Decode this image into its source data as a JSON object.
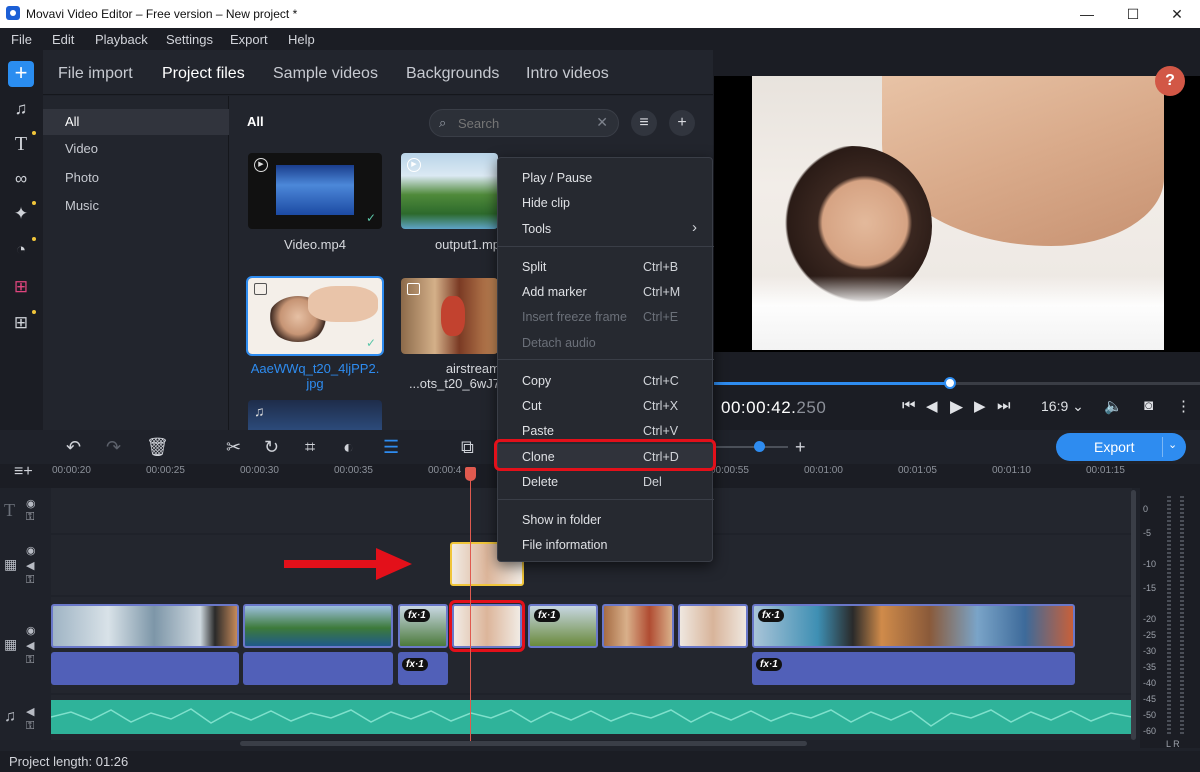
{
  "window": {
    "title": "Movavi Video Editor – Free version – New project *",
    "min": "—",
    "max": "☐",
    "close": "✕"
  },
  "menu": [
    "File",
    "Edit",
    "Playback",
    "Settings",
    "Export",
    "Help"
  ],
  "media_tabs": [
    "File import",
    "Project files",
    "Sample videos",
    "Backgrounds",
    "Intro videos"
  ],
  "categories": [
    "All",
    "Video",
    "Photo",
    "Music"
  ],
  "files_panel": {
    "heading": "All",
    "search_placeholder": "Search"
  },
  "files": [
    {
      "name": "Video.mp4",
      "type": "video"
    },
    {
      "name": "output1.mp",
      "type": "video"
    },
    {
      "name": "AaeWWq_t20_4ljPP2.",
      "name2": "jpg",
      "type": "image"
    },
    {
      "name": "airstream",
      "name2": "...ots_t20_6wJ7",
      "type": "image"
    }
  ],
  "context_menu": [
    {
      "label": "Play / Pause",
      "key": ""
    },
    {
      "label": "Hide clip",
      "key": ""
    },
    {
      "label": "Tools",
      "key": "›"
    },
    {
      "label": "Split",
      "key": "Ctrl+B"
    },
    {
      "label": "Add marker",
      "key": "Ctrl+M"
    },
    {
      "label": "Insert freeze frame",
      "key": "Ctrl+E"
    },
    {
      "label": "Detach audio",
      "key": ""
    },
    {
      "label": "Copy",
      "key": "Ctrl+C"
    },
    {
      "label": "Cut",
      "key": "Ctrl+X"
    },
    {
      "label": "Paste",
      "key": "Ctrl+V"
    },
    {
      "label": "Clone",
      "key": "Ctrl+D"
    },
    {
      "label": "Delete",
      "key": "Del"
    },
    {
      "label": "Show in folder",
      "key": ""
    },
    {
      "label": "File information",
      "key": ""
    }
  ],
  "player": {
    "time_main": "00:00:42.",
    "time_ms": "250",
    "aspect": "16:9 ⌄",
    "progress": 0.485
  },
  "help": "?",
  "export": {
    "label": "Export",
    "dropdown": "⌄"
  },
  "ruler": [
    "00:00:20",
    "00:00:25",
    "00:00:30",
    "00:00:35",
    "00:00:4",
    "00:00:55",
    "00:01:00",
    "00:01:05",
    "00:01:10",
    "00:01:15"
  ],
  "fx_label": "fx·1",
  "meter": [
    "0",
    "-5",
    "-10",
    "-15",
    "-20",
    "-25",
    "-30",
    "-35",
    "-40",
    "-45",
    "-50",
    "-60"
  ],
  "meter_lr": "L  R",
  "status": {
    "project_length": "Project length: 01:26"
  },
  "colors": {
    "accent": "#2e8cf0",
    "highlight": "#e3101a",
    "clip_border": "#6a78c9",
    "audio": "#2fb39a",
    "help": "#d25746"
  }
}
